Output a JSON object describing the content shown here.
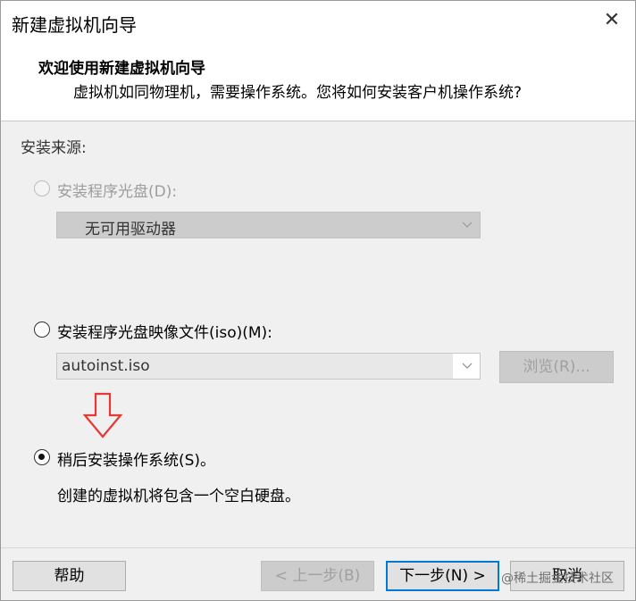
{
  "window": {
    "title": "新建虚拟机向导",
    "close_glyph": "✕"
  },
  "header": {
    "heading": "欢迎使用新建虚拟机向导",
    "subheading": "虚拟机如同物理机，需要操作系统。您将如何安装客户机操作系统?"
  },
  "source": {
    "group_label": "安装来源:",
    "disc": {
      "label": "安装程序光盘(D):",
      "selected": false,
      "enabled": false,
      "dropdown_value": "无可用驱动器"
    },
    "iso": {
      "label": "安装程序光盘映像文件(iso)(M):",
      "selected": false,
      "enabled": true,
      "path_value": "autoinst.iso",
      "browse_label": "浏览(R)..."
    },
    "later": {
      "label": "稍后安装操作系统(S)。",
      "selected": true,
      "description": "创建的虚拟机将包含一个空白硬盘。"
    }
  },
  "annotation": {
    "arrow_icon": "down-arrow-icon",
    "arrow_color": "#e53935"
  },
  "footer": {
    "help_label": "帮助",
    "back_label": "< 上一步(B)",
    "next_label": "下一步(N) >",
    "cancel_label": "取消"
  },
  "watermark": "@稀土掘金技术社区"
}
